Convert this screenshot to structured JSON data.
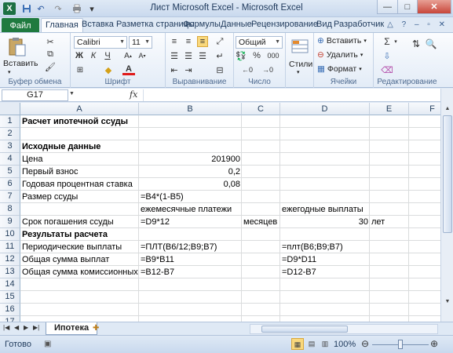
{
  "window": {
    "title": "Лист Microsoft Excel - Microsoft Excel",
    "app_icon": "X"
  },
  "ribbon_tabs": {
    "file": "Файл",
    "items": [
      "Главная",
      "Вставка",
      "Разметка страницы",
      "Формулы",
      "Данные",
      "Рецензирование",
      "Вид",
      "Разработчик"
    ]
  },
  "ribbon": {
    "clipboard": {
      "paste": "Вставить",
      "label": "Буфер обмена"
    },
    "font": {
      "name": "Calibri",
      "size": "11",
      "bold": "Ж",
      "italic": "К",
      "underline": "Ч",
      "label": "Шрифт"
    },
    "alignment": {
      "label": "Выравнивание"
    },
    "number": {
      "format": "Общий",
      "percent": "%",
      "thousands": "000",
      "label": "Число"
    },
    "styles": {
      "button": "Стили"
    },
    "cells": {
      "insert": "Вставить",
      "delete": "Удалить",
      "format": "Формат",
      "label": "Ячейки"
    },
    "editing": {
      "label": "Редактирование"
    }
  },
  "formula_bar": {
    "name_box": "G17",
    "fx": "fx",
    "value": ""
  },
  "columns": [
    "A",
    "B",
    "C",
    "D",
    "E",
    "F"
  ],
  "rows": [
    "1",
    "2",
    "3",
    "4",
    "5",
    "6",
    "7",
    "8",
    "9",
    "10",
    "11",
    "12",
    "13",
    "14",
    "15",
    "16",
    "17"
  ],
  "cells": {
    "A1": "Расчет ипотечной ссуды",
    "A3": "Исходные данные",
    "A4": "Цена",
    "B4": "201900",
    "A5": "Первый взнос",
    "B5": "0,2",
    "A6": "Годовая процентная ставка",
    "B6": "0,08",
    "A7": "Размер ссуды",
    "B7": "=B4*(1-B5)",
    "B8": "ежемесячные платежи",
    "D8": "ежегодные выплаты",
    "A9": "Срок погашения ссуды",
    "B9": "=D9*12",
    "C9": "месяцев",
    "D9": "30",
    "E9": "лет",
    "A10": "Результаты расчета",
    "A11": "Периодические выплаты",
    "B11": "=ПЛТ(B6/12;B9;B7)",
    "D11": "=плт(B6;B9;B7)",
    "A12": "Общая сумма выплат",
    "B12": "=B9*B11",
    "D12": "=D9*D11",
    "A13": "Общая сумма комиссионных",
    "B13": "=B12-B7",
    "D13": "=D12-B7"
  },
  "sheet_tabs": {
    "active": "Ипотека"
  },
  "status": {
    "text": "Готово",
    "zoom": "100%",
    "zoom_fraction": 0.5
  }
}
